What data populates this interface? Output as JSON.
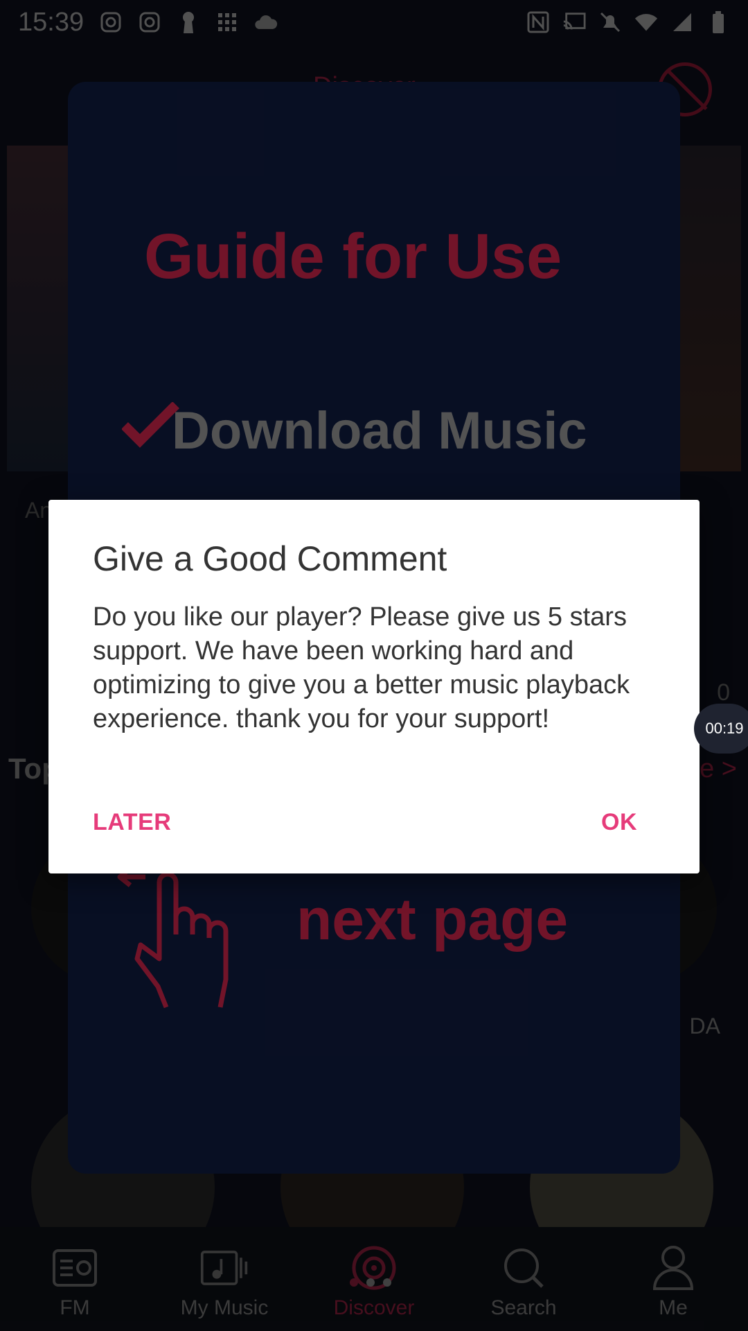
{
  "status_bar": {
    "time": "15:39",
    "left_icons": [
      "camera-circle-icon",
      "camera-circle-icon",
      "keyhole-icon",
      "grid-icon",
      "cloud-icon"
    ],
    "right_icons": [
      "nfc-icon",
      "cast-icon",
      "bell-off-icon",
      "wifi-icon",
      "signal-icon",
      "battery-icon"
    ]
  },
  "header": {
    "title": "Discover"
  },
  "background": {
    "banner_caption": "An",
    "section_title": "Top",
    "more_label": "More >",
    "side_number": "0",
    "song_caption": "DA"
  },
  "timer": {
    "label": "00:19"
  },
  "guide": {
    "title": "Guide for Use",
    "download_label": "Download Music",
    "next_label": "next page"
  },
  "dialog": {
    "title": "Give a Good Comment",
    "message": "Do you like our player? Please give us 5 stars support. We have been working hard and optimizing to give you a better music playback experience. thank you for your support!",
    "later_label": "LATER",
    "ok_label": "OK"
  },
  "bottom_nav": {
    "items": [
      {
        "label": "FM",
        "icon": "radio-icon"
      },
      {
        "label": "My Music",
        "icon": "music-note-icon"
      },
      {
        "label": "Discover",
        "icon": "disc-icon"
      },
      {
        "label": "Search",
        "icon": "search-icon"
      },
      {
        "label": "Me",
        "icon": "person-icon"
      }
    ],
    "active_index": 2
  },
  "colors": {
    "accent": "#e63b7a",
    "brand_red": "#e0305f",
    "guide_red": "#c42447"
  }
}
